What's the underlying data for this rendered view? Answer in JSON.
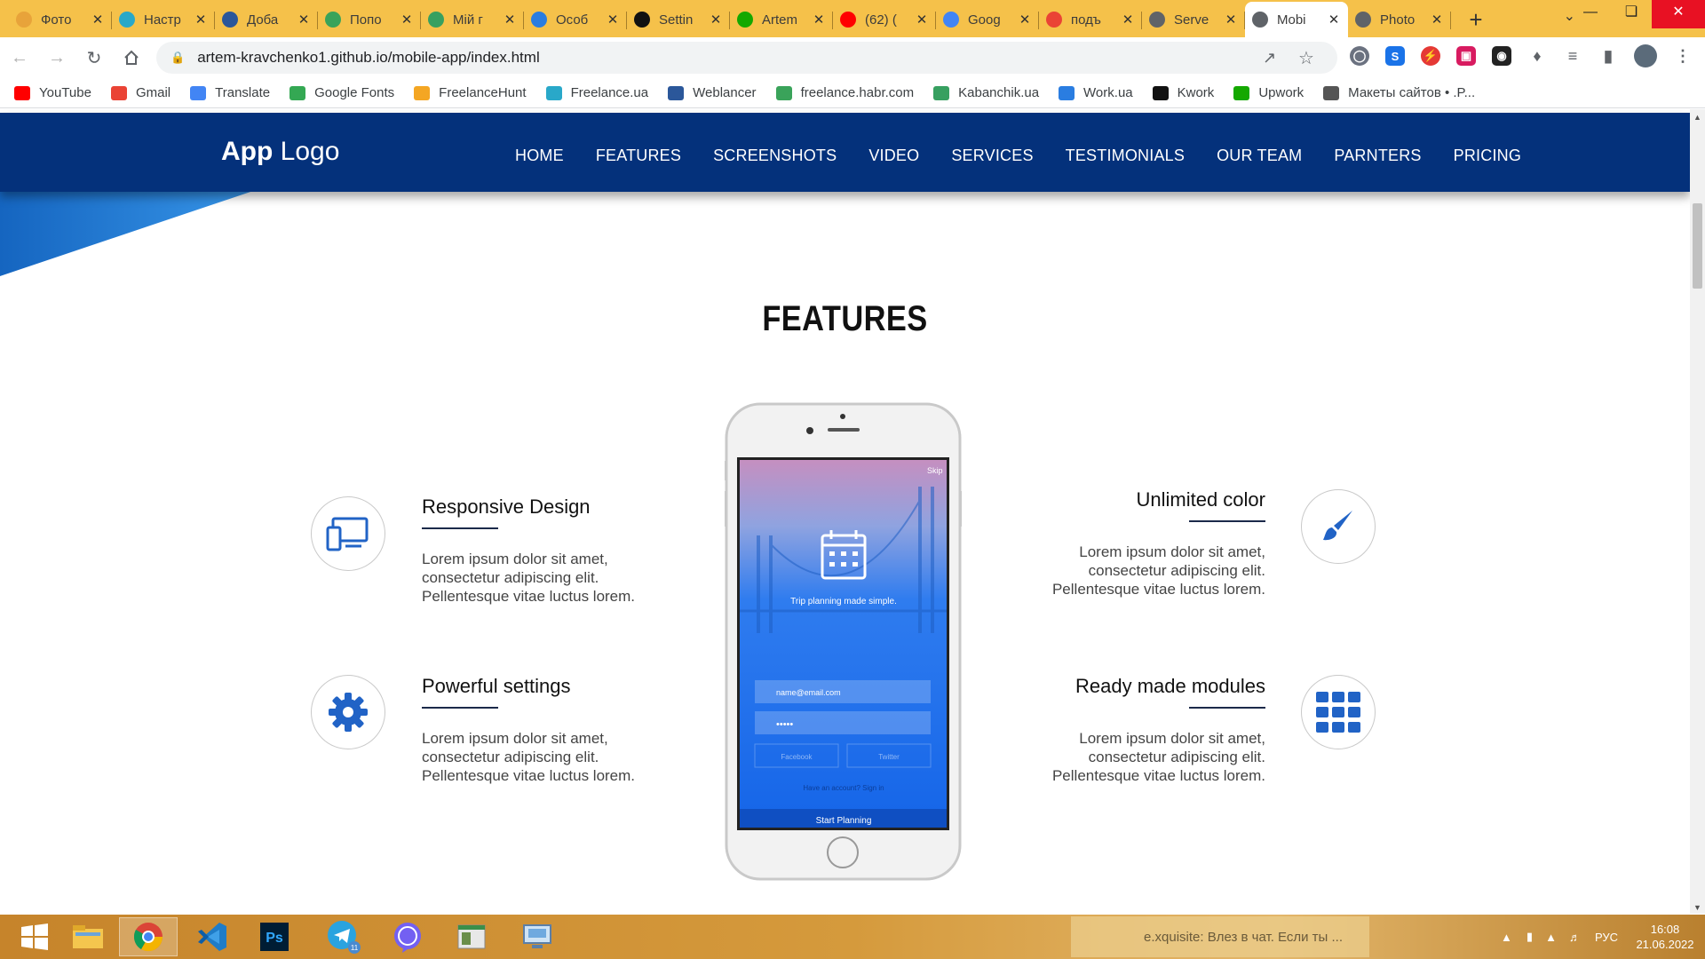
{
  "browser": {
    "tabs": [
      {
        "title": "Фото",
        "icon": "photo-app-icon",
        "color": "#e8a33a"
      },
      {
        "title": "Настр",
        "icon": "freelance-ua-icon",
        "color": "#29a8c9"
      },
      {
        "title": "Доба",
        "icon": "word-icon",
        "color": "#2b579a"
      },
      {
        "title": "Попо",
        "icon": "habr-freelance-icon",
        "color": "#3aa35a"
      },
      {
        "title": "Мій г",
        "icon": "kabanchik-icon",
        "color": "#37a060"
      },
      {
        "title": "Особ",
        "icon": "work-ua-icon",
        "color": "#2a7de1"
      },
      {
        "title": "Settin",
        "icon": "kwork-icon",
        "color": "#111111"
      },
      {
        "title": "Artem",
        "icon": "upwork-icon",
        "color": "#14a800"
      },
      {
        "title": "(62) (",
        "icon": "youtube-icon",
        "color": "#ff0000"
      },
      {
        "title": "Goog",
        "icon": "google-translate-icon",
        "color": "#4285f4"
      },
      {
        "title": "подъ",
        "icon": "google-icon",
        "color": "#ea4335"
      },
      {
        "title": "Serve",
        "icon": "globe-icon",
        "color": "#5f6368"
      },
      {
        "title": "Mobi",
        "icon": "globe-icon",
        "color": "#5f6368",
        "active": true
      },
      {
        "title": "Photo",
        "icon": "globe-icon",
        "color": "#5f6368"
      }
    ],
    "url": "artem-kravchenko1.github.io/mobile-app/index.html",
    "bookmarks": [
      {
        "label": "YouTube",
        "icon": "youtube-icon",
        "color": "#ff0000"
      },
      {
        "label": "Gmail",
        "icon": "gmail-icon",
        "color": "#ea4335"
      },
      {
        "label": "Translate",
        "icon": "google-translate-icon",
        "color": "#4285f4"
      },
      {
        "label": "Google Fonts",
        "icon": "google-fonts-icon",
        "color": "#34a853"
      },
      {
        "label": "FreelanceHunt",
        "icon": "freelancehunt-icon",
        "color": "#f4a623"
      },
      {
        "label": "Freelance.ua",
        "icon": "freelance-ua-icon",
        "color": "#29a8c9"
      },
      {
        "label": "Weblancer",
        "icon": "weblancer-icon",
        "color": "#2b579a"
      },
      {
        "label": "freelance.habr.com",
        "icon": "habr-freelance-icon",
        "color": "#3aa35a"
      },
      {
        "label": "Kabanchik.ua",
        "icon": "kabanchik-icon",
        "color": "#37a060"
      },
      {
        "label": "Work.ua",
        "icon": "work-ua-icon",
        "color": "#2a7de1"
      },
      {
        "label": "Kwork",
        "icon": "kwork-icon",
        "color": "#111111"
      },
      {
        "label": "Upwork",
        "icon": "upwork-icon",
        "color": "#14a800"
      },
      {
        "label": "Макеты сайтов • .P...",
        "icon": "layouts-icon",
        "color": "#555555"
      }
    ]
  },
  "site": {
    "logo_bold": "App",
    "logo_light": " Logo",
    "nav": [
      "HOME",
      "FEATURES",
      "SCREENSHOTS",
      "VIDEO",
      "SERVICES",
      "TESTIMONIALS",
      "OUR TEAM",
      "PARNTERS",
      "PRICING"
    ],
    "brand_color": "#04317b",
    "accent_color": "#2163c6"
  },
  "features": {
    "title": "FEATURES",
    "items": [
      {
        "title": "Responsive Design",
        "line1": "Lorem ipsum dolor sit amet,",
        "line2": "consectetur adipiscing elit.",
        "line3": "Pellentesque vitae luctus lorem.",
        "icon": "devices-icon"
      },
      {
        "title": "Powerful settings",
        "line1": "Lorem ipsum dolor sit amet,",
        "line2": "consectetur adipiscing elit.",
        "line3": "Pellentesque vitae luctus lorem.",
        "icon": "gear-icon"
      },
      {
        "title": "Unlimited color",
        "line1": "Lorem ipsum dolor sit amet,",
        "line2": "consectetur adipiscing elit.",
        "line3": "Pellentesque vitae luctus lorem.",
        "icon": "paintbrush-icon"
      },
      {
        "title": "Ready made modules",
        "line1": "Lorem ipsum dolor sit amet,",
        "line2": "consectetur adipiscing elit.",
        "line3": "Pellentesque vitae luctus lorem.",
        "icon": "grid-modules-icon"
      }
    ],
    "phone": {
      "skip": "Skip",
      "tagline": "Trip planning made simple.",
      "email_placeholder": "name@email.com",
      "password_mask": "•••••",
      "facebook": "Facebook",
      "twitter": "Twitter",
      "have_account": "Have an account? Sign in",
      "cta": "Start Planning"
    }
  },
  "taskbar": {
    "apps": [
      "file-explorer-icon",
      "chrome-icon",
      "vscode-icon",
      "photoshop-icon",
      "telegram-icon",
      "viber-icon",
      "notepad-icon",
      "remote-desktop-icon"
    ],
    "telegram_badge": "11",
    "notification": "e.xquisite: Влез в чат. Если ты ...",
    "language": "РУС",
    "time": "16:08",
    "date": "21.06.2022"
  }
}
